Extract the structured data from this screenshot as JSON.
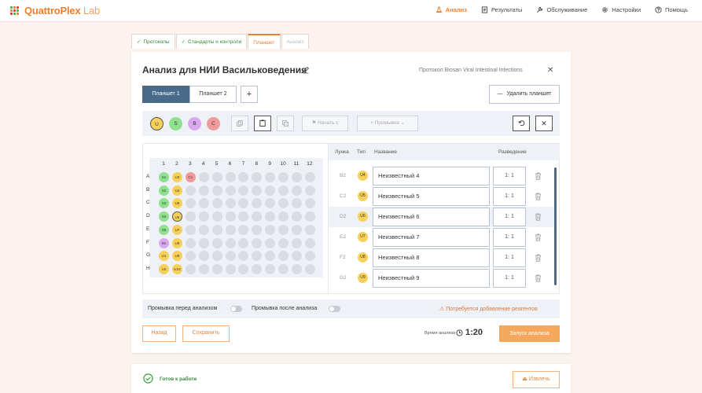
{
  "header": {
    "logo_bold": "Quattro",
    "logo_mid": "Plex",
    "logo_light": " Lab",
    "logo_colors": [
      "#4caf50",
      "#f07d2a",
      "#e53935",
      "#f07d2a",
      "#e53935",
      "#4caf50",
      "#e53935",
      "#4caf50",
      "#f07d2a"
    ],
    "nav": [
      {
        "label": "Анализ",
        "icon": "flask-icon",
        "active": true
      },
      {
        "label": "Результаты",
        "icon": "document-icon",
        "active": false
      },
      {
        "label": "Обслуживание",
        "icon": "wrench-icon",
        "active": false
      },
      {
        "label": "Настройки",
        "icon": "gear-icon",
        "active": false
      },
      {
        "label": "Помощь",
        "icon": "help-icon",
        "active": false
      }
    ]
  },
  "steps": [
    {
      "label": "Протоколы",
      "state": "done"
    },
    {
      "label": "Стандарты и контроли",
      "state": "done"
    },
    {
      "label": "Планшет",
      "state": "current"
    },
    {
      "label": "Анализ",
      "state": "disabled"
    }
  ],
  "main": {
    "title": "Анализ для НИИ Васильковедения",
    "protocol": "Протокол Biosan Viral Intestinal Infections",
    "plate_tabs": [
      "Планшет 1",
      "Планшет 2"
    ],
    "add_tab": "+",
    "delete_plate": "Удалить планшет",
    "toolbar": {
      "chips": [
        {
          "label": "U",
          "color": "#f7d05a",
          "selected": true
        },
        {
          "label": "S",
          "color": "#8fe08f",
          "selected": false
        },
        {
          "label": "B",
          "color": "#d9a8f0",
          "selected": false
        },
        {
          "label": "C",
          "color": "#f19a9a",
          "selected": false
        }
      ],
      "start_from": "Начать с",
      "wash": "Промывка"
    },
    "grid": {
      "columns": [
        "1",
        "2",
        "3",
        "4",
        "5",
        "6",
        "7",
        "8",
        "9",
        "10",
        "11",
        "12"
      ],
      "rows": [
        "A",
        "B",
        "C",
        "D",
        "E",
        "F",
        "G",
        "H"
      ],
      "filled": [
        {
          "row": 0,
          "col": 0,
          "label": "S1",
          "color": "#8fe08f"
        },
        {
          "row": 0,
          "col": 1,
          "label": "U3",
          "color": "#f7d05a"
        },
        {
          "row": 0,
          "col": 2,
          "label": "C1",
          "color": "#f19a9a"
        },
        {
          "row": 1,
          "col": 0,
          "label": "S2",
          "color": "#8fe08f"
        },
        {
          "row": 1,
          "col": 1,
          "label": "U4",
          "color": "#f7d05a"
        },
        {
          "row": 2,
          "col": 0,
          "label": "S3",
          "color": "#8fe08f"
        },
        {
          "row": 2,
          "col": 1,
          "label": "U5",
          "color": "#f7d05a"
        },
        {
          "row": 3,
          "col": 0,
          "label": "S4",
          "color": "#8fe08f"
        },
        {
          "row": 3,
          "col": 1,
          "label": "U6",
          "color": "#f7d05a",
          "ring": true
        },
        {
          "row": 4,
          "col": 0,
          "label": "S5",
          "color": "#8fe08f"
        },
        {
          "row": 4,
          "col": 1,
          "label": "U7",
          "color": "#f7d05a"
        },
        {
          "row": 5,
          "col": 0,
          "label": "B1",
          "color": "#d9a8f0"
        },
        {
          "row": 5,
          "col": 1,
          "label": "U8",
          "color": "#f7d05a"
        },
        {
          "row": 6,
          "col": 0,
          "label": "U1",
          "color": "#f7d05a"
        },
        {
          "row": 6,
          "col": 1,
          "label": "U9",
          "color": "#f7d05a"
        },
        {
          "row": 7,
          "col": 0,
          "label": "U2",
          "color": "#f7d05a"
        },
        {
          "row": 7,
          "col": 1,
          "label": "U10",
          "color": "#f7d05a"
        }
      ]
    },
    "table": {
      "headers": {
        "well": "Лунка",
        "type": "Тип",
        "name": "Название",
        "dilution": "Разведение"
      },
      "rows": [
        {
          "well": "B2",
          "type": "U4",
          "name": "Неизвестный 4",
          "dilution": "1: 1",
          "highlight": false
        },
        {
          "well": "C2",
          "type": "U5",
          "name": "Неизвестный 5",
          "dilution": "1: 1",
          "highlight": false
        },
        {
          "well": "D2",
          "type": "U6",
          "name": "Неизвестный 6",
          "dilution": "1: 1",
          "highlight": true
        },
        {
          "well": "E2",
          "type": "U7",
          "name": "Неизвестный 7",
          "dilution": "1: 1",
          "highlight": false
        },
        {
          "well": "F2",
          "type": "U8",
          "name": "Неизвестный 8",
          "dilution": "1: 1",
          "highlight": false
        },
        {
          "well": "G2",
          "type": "U9",
          "name": "Неизвестный 9",
          "dilution": "1: 1",
          "highlight": false
        }
      ]
    },
    "wash_before": "Промывка перед анализом",
    "wash_after": "Промывка после анализа",
    "warning": "Потребуется добавление реагентов",
    "back": "Назад",
    "save": "Сохранить",
    "time_label": "Время анализа",
    "time_value": "1:20",
    "start": "Запуск анализа"
  },
  "status": {
    "ready": "Готов к работе",
    "eject": "Извлечь"
  }
}
